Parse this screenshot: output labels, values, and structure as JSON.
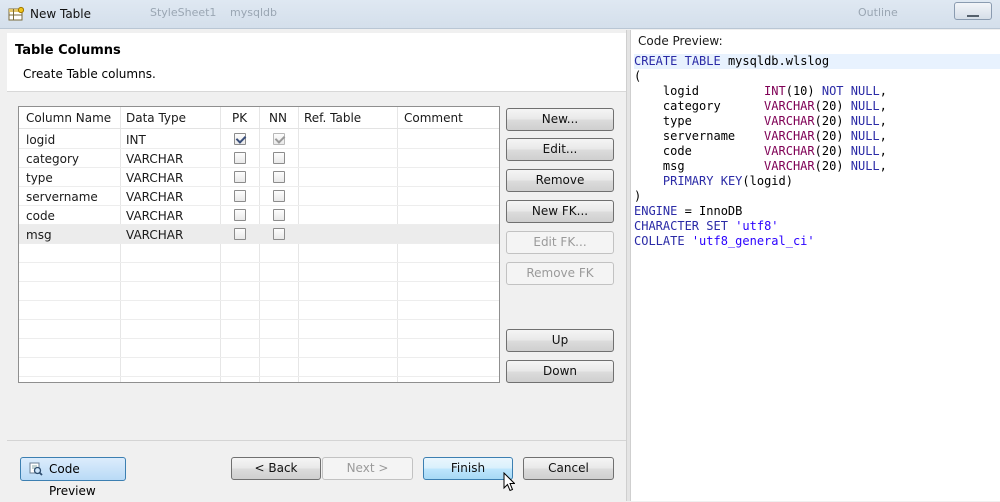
{
  "window": {
    "title": "New Table",
    "ghost_tabs": [
      "StyleSheet1",
      "mysqldb",
      "Outline"
    ]
  },
  "header": {
    "title": "Table Columns",
    "subtitle": "Create Table columns."
  },
  "table": {
    "columns": [
      "Column Name",
      "Data Type",
      "PK",
      "NN",
      "Ref. Table",
      "Comment"
    ],
    "rows": [
      {
        "name": "logid",
        "type": "INT",
        "pk": true,
        "nn": true,
        "ref": "",
        "comment": ""
      },
      {
        "name": "category",
        "type": "VARCHAR",
        "pk": false,
        "nn": false,
        "ref": "",
        "comment": ""
      },
      {
        "name": "type",
        "type": "VARCHAR",
        "pk": false,
        "nn": false,
        "ref": "",
        "comment": ""
      },
      {
        "name": "servername",
        "type": "VARCHAR",
        "pk": false,
        "nn": false,
        "ref": "",
        "comment": ""
      },
      {
        "name": "code",
        "type": "VARCHAR",
        "pk": false,
        "nn": false,
        "ref": "",
        "comment": ""
      },
      {
        "name": "msg",
        "type": "VARCHAR",
        "pk": false,
        "nn": false,
        "ref": "",
        "comment": ""
      }
    ],
    "selected_row": 5
  },
  "side_buttons": {
    "new": "New...",
    "edit": "Edit...",
    "remove": "Remove",
    "new_fk": "New FK...",
    "edit_fk": "Edit FK...",
    "remove_fk": "Remove FK",
    "up": "Up",
    "down": "Down"
  },
  "footer": {
    "code_preview": "Code Preview",
    "back": "< Back",
    "next": "Next >",
    "finish": "Finish",
    "cancel": "Cancel"
  },
  "preview": {
    "title": "Code Preview:",
    "lines": [
      "CREATE TABLE mysqldb.wlslog",
      "(",
      "    logid         INT(10) NOT NULL,",
      "    category      VARCHAR(20) NULL,",
      "    type          VARCHAR(20) NULL,",
      "    servername    VARCHAR(20) NULL,",
      "    code          VARCHAR(20) NULL,",
      "    msg           VARCHAR(20) NULL,",
      "    PRIMARY KEY(logid)",
      ")",
      "ENGINE = InnoDB",
      "CHARACTER SET 'utf8'",
      "COLLATE 'utf8_general_ci'"
    ]
  },
  "colors": {
    "keyword": "#2a2aa6",
    "type": "#7f0055",
    "string": "#2a00ff",
    "selection": "#e8f2fe"
  }
}
